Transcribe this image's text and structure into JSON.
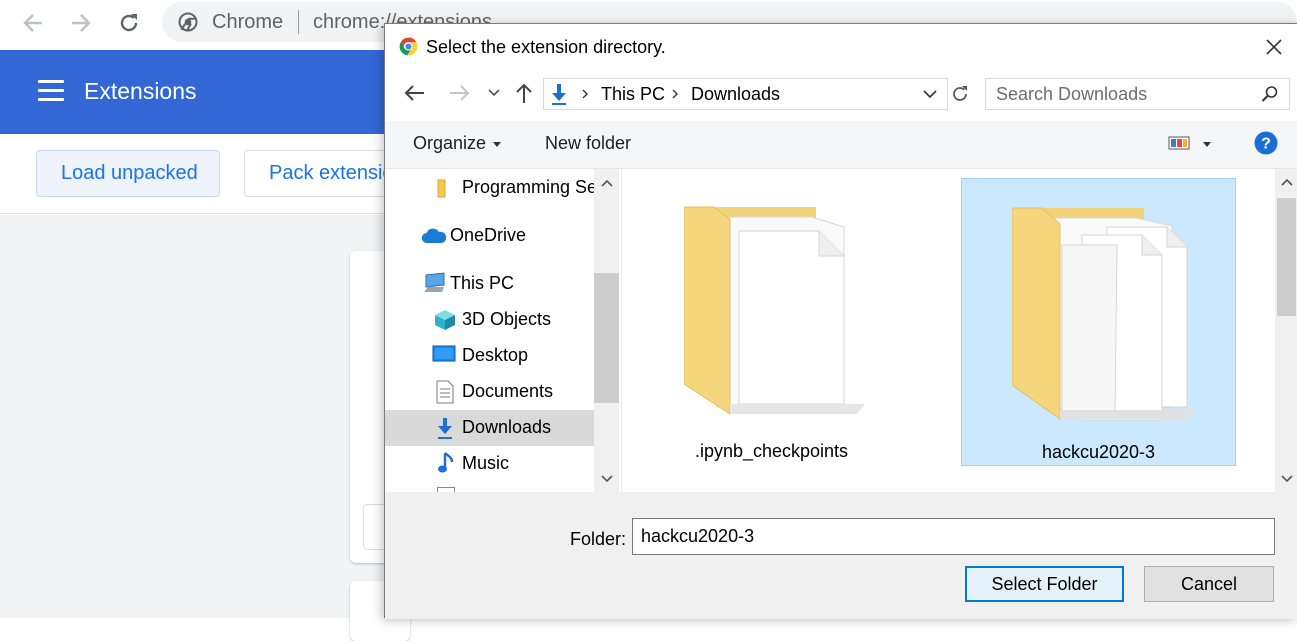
{
  "browser": {
    "site_name": "Chrome",
    "url": "chrome://extensions",
    "icons": {
      "back": "back-arrow-icon",
      "forward": "forward-arrow-icon",
      "reload": "reload-icon",
      "site": "chrome-site-icon"
    }
  },
  "extensions_page": {
    "title": "Extensions",
    "buttons": {
      "load_unpacked": "Load unpacked",
      "pack_extension": "Pack extension"
    },
    "header_color": "#3367d6"
  },
  "dialog": {
    "title": "Select the extension directory.",
    "breadcrumb": [
      "This PC",
      "Downloads"
    ],
    "search_placeholder": "Search Downloads",
    "commands": {
      "organize": "Organize",
      "new_folder": "New folder"
    },
    "nav_items": [
      {
        "label": "Programming Se",
        "icon": "folder-icon"
      },
      {
        "label": "OneDrive",
        "icon": "onedrive-cloud-icon"
      },
      {
        "label": "This PC",
        "icon": "this-pc-icon"
      },
      {
        "label": "3D Objects",
        "icon": "3d-objects-icon"
      },
      {
        "label": "Desktop",
        "icon": "desktop-icon"
      },
      {
        "label": "Documents",
        "icon": "documents-icon"
      },
      {
        "label": "Downloads",
        "icon": "downloads-icon",
        "selected": true
      },
      {
        "label": "Music",
        "icon": "music-icon"
      }
    ],
    "files": [
      {
        "name": ".ipynb_checkpoints",
        "selected": false
      },
      {
        "name": "hackcu2020-3",
        "selected": true
      }
    ],
    "folder_label": "Folder:",
    "folder_value": "hackcu2020-3",
    "buttons": {
      "select": "Select Folder",
      "cancel": "Cancel"
    },
    "accent_color": "#0078d7"
  }
}
